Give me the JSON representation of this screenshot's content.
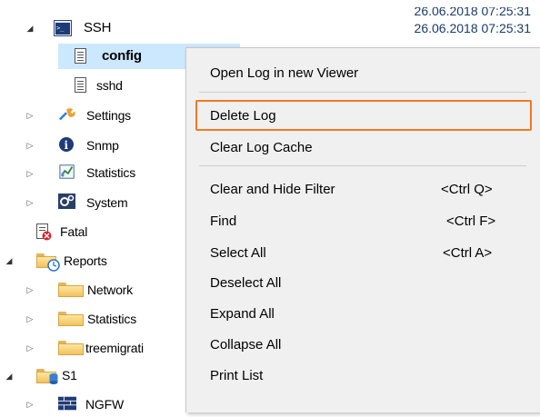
{
  "timestamps": [
    "26.06.2018 07:25:31",
    "26.06.2018 07:25:31"
  ],
  "tree": {
    "ssh": "SSH",
    "config": "config",
    "sshd": "sshd",
    "settings": "Settings",
    "snmp": "Snmp",
    "statistics": "Statistics",
    "system": "System",
    "fatal": "Fatal",
    "reports": "Reports",
    "network": "Network",
    "reports_statistics": "Statistics",
    "treemigration": "treemigrati",
    "s1": "S1",
    "ngfw": "NGFW"
  },
  "menu": {
    "open_log": "Open Log in new Viewer",
    "delete_log": "Delete Log",
    "clear_cache": "Clear Log Cache",
    "clear_hide_filter": "Clear and Hide Filter",
    "clear_hide_filter_key": "<Ctrl Q>",
    "find": "Find",
    "find_key": "<Ctrl F>",
    "select_all": "Select All",
    "select_all_key": "<Ctrl A>",
    "deselect_all": "Deselect All",
    "expand_all": "Expand All",
    "collapse_all": "Collapse All",
    "print_list": "Print List"
  },
  "colors": {
    "highlight_border": "#f07a22",
    "selection": "#cce8ff"
  }
}
